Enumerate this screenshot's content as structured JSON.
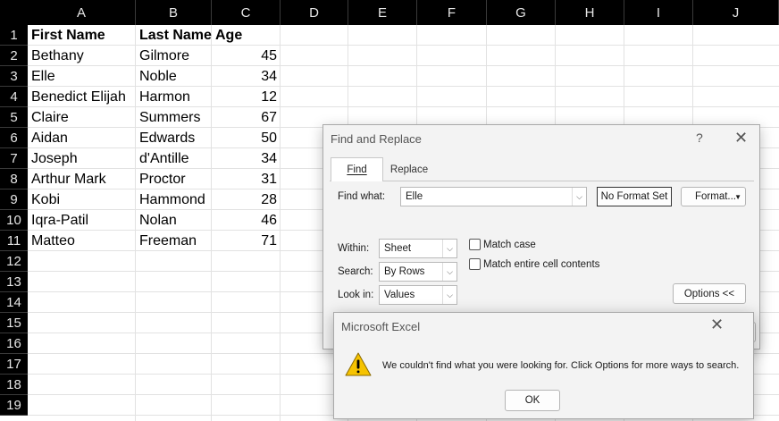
{
  "sheet": {
    "columns": [
      "A",
      "B",
      "C",
      "D",
      "E",
      "F",
      "G",
      "H",
      "I",
      "J"
    ],
    "rows": [
      "1",
      "2",
      "3",
      "4",
      "5",
      "6",
      "7",
      "8",
      "9",
      "10",
      "11",
      "12",
      "13",
      "14",
      "15",
      "16",
      "17",
      "18",
      "19"
    ],
    "headers": [
      "First Name",
      "Last Name",
      "Age"
    ],
    "data": [
      [
        "Bethany",
        "Gilmore",
        "45"
      ],
      [
        "Elle",
        "Noble",
        "34"
      ],
      [
        "Benedict Elijah",
        "Harmon",
        "12"
      ],
      [
        "Claire",
        "Summers",
        "67"
      ],
      [
        "Aidan",
        "Edwards",
        "50"
      ],
      [
        "Joseph",
        "d'Antille",
        "34"
      ],
      [
        "Arthur Mark",
        "Proctor",
        "31"
      ],
      [
        "Kobi",
        "Hammond",
        "28"
      ],
      [
        "Iqra-Patil",
        "Nolan",
        "46"
      ],
      [
        "Matteo",
        "Freeman",
        "71"
      ]
    ]
  },
  "find_dialog": {
    "title": "Find and Replace",
    "help": "?",
    "close": "✕",
    "tabs": [
      "Find",
      "Replace"
    ],
    "find_what_label": "Find what:",
    "find_what_value": "Elle",
    "no_format_label": "No Format Set",
    "format_label": "Format...",
    "within_label": "Within:",
    "within_value": "Sheet",
    "search_label": "Search:",
    "search_value": "By Rows",
    "look_in_label": "Look in:",
    "look_in_value": "Values",
    "match_case_label": "Match case",
    "match_entire_label": "Match entire cell contents",
    "options_label": "Options <<"
  },
  "message_box": {
    "title": "Microsoft Excel",
    "close": "✕",
    "message": "We couldn't find what you were looking for. Click Options for more ways to search.",
    "ok_label": "OK",
    "icon": "warning-icon"
  }
}
